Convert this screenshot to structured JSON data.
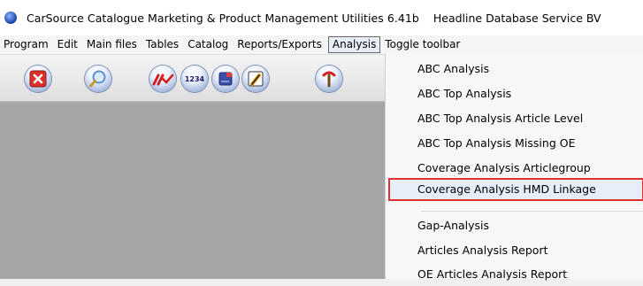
{
  "window": {
    "title": "CarSource Catalogue Marketing & Product Management Utilities  6.41b",
    "company": "Headline Database Service BV"
  },
  "menubar": {
    "items": [
      {
        "label": "Program"
      },
      {
        "label": "Edit"
      },
      {
        "label": "Main files"
      },
      {
        "label": "Tables"
      },
      {
        "label": "Catalog"
      },
      {
        "label": "Reports/Exports"
      },
      {
        "label": "Analysis"
      },
      {
        "label": "Toggle toolbar"
      }
    ]
  },
  "toolbar": {
    "buttons": [
      {
        "icon": "close-icon"
      },
      {
        "icon": "search-icon"
      },
      {
        "icon": "chart-icon"
      },
      {
        "icon": "numbers-1234-icon",
        "text": "1234"
      },
      {
        "icon": "tasks-icon"
      },
      {
        "icon": "kba-icon",
        "text": "Kba"
      },
      {
        "icon": "tools-icon"
      }
    ]
  },
  "analysis_menu": {
    "items": [
      {
        "label": "ABC Analysis"
      },
      {
        "label": "ABC Top Analysis"
      },
      {
        "label": "ABC Top Analysis Article Level"
      },
      {
        "label": "ABC Top Analysis Missing OE"
      },
      {
        "label": "Coverage Analysis Articlegroup"
      },
      {
        "label": "Coverage Analysis HMD Linkage",
        "highlighted": true
      },
      {
        "label": "Gap-Analysis"
      },
      {
        "label": "Articles Analysis Report"
      },
      {
        "label": "OE Articles Analysis Report"
      }
    ]
  },
  "colors": {
    "workspace": "#a6a6a6",
    "highlight_border": "#e03030",
    "close_button": "#d9322a"
  }
}
